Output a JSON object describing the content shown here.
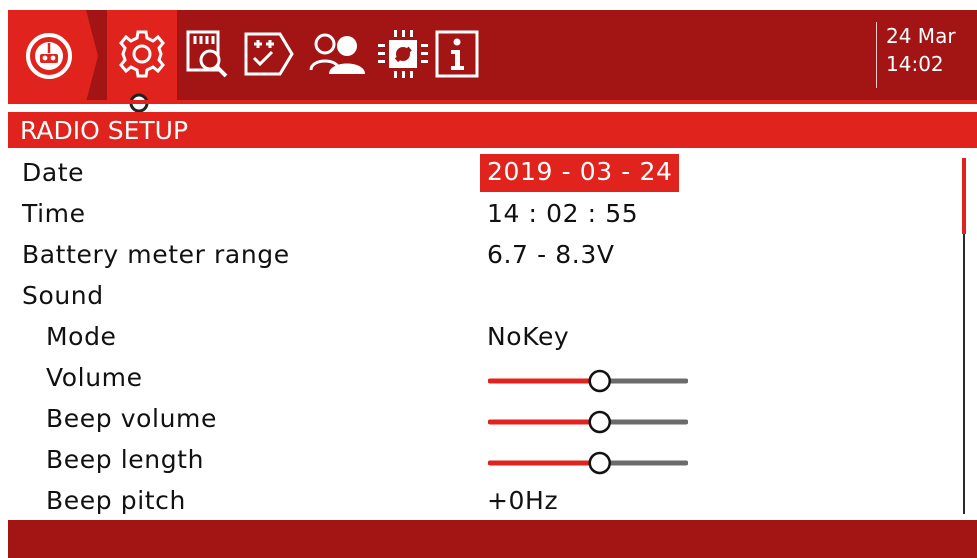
{
  "header": {
    "tabs": [
      {
        "name": "radio-setup-tab",
        "icon": "gear-icon",
        "selected": true
      },
      {
        "name": "sd-manager-tab",
        "icon": "sd-card-search-icon",
        "selected": false
      },
      {
        "name": "global-functions-tab",
        "icon": "checklist-icon",
        "selected": false
      },
      {
        "name": "trainer-tab",
        "icon": "users-icon",
        "selected": false
      },
      {
        "name": "hardware-tab",
        "icon": "chip-wrench-icon",
        "selected": false
      },
      {
        "name": "version-tab",
        "icon": "info-icon",
        "selected": false
      }
    ],
    "date": "24 Mar",
    "time": "14:02"
  },
  "title": "RADIO SETUP",
  "rows": [
    {
      "label": "Date",
      "value": "2019 - 03 - 24",
      "selected": true
    },
    {
      "label": "Time",
      "value": "14 : 02 : 55"
    },
    {
      "label": "Battery meter range",
      "value": "6.7 - 8.3V"
    },
    {
      "label": "Sound"
    },
    {
      "label": "Mode",
      "value": "NoKey"
    },
    {
      "label": "Volume",
      "level": 0.5
    },
    {
      "label": "Beep volume",
      "level": 0.5
    },
    {
      "label": "Beep length",
      "level": 0.5
    },
    {
      "label": "Beep pitch",
      "value": "+0Hz"
    }
  ],
  "colors": {
    "dark_red": "#a31515",
    "accent_red": "#e0231c",
    "slider_gray": "#6b6b6b"
  }
}
